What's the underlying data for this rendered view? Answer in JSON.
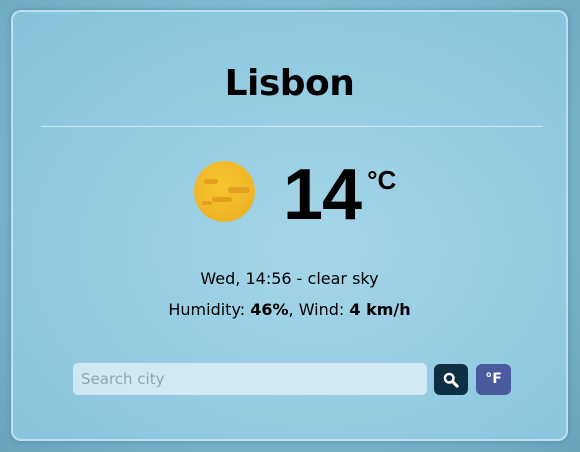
{
  "weather": {
    "city": "Lisbon",
    "temperature": "14",
    "unit": "°C",
    "day_time_condition": "Wed, 14:56 - clear sky",
    "humidity_label": "Humidity: ",
    "humidity_value": "46%",
    "wind_label": ", Wind: ",
    "wind_value": "4 km/h",
    "condition_icon": "sun-icon"
  },
  "search": {
    "placeholder": "Search city",
    "button_icon": "search-icon",
    "unit_toggle_label": "°F"
  },
  "colors": {
    "card_background": "#93cbe1",
    "sun": "#f1b92a",
    "search_button": "#0d2f44",
    "unit_button": "#4a5a9e"
  }
}
